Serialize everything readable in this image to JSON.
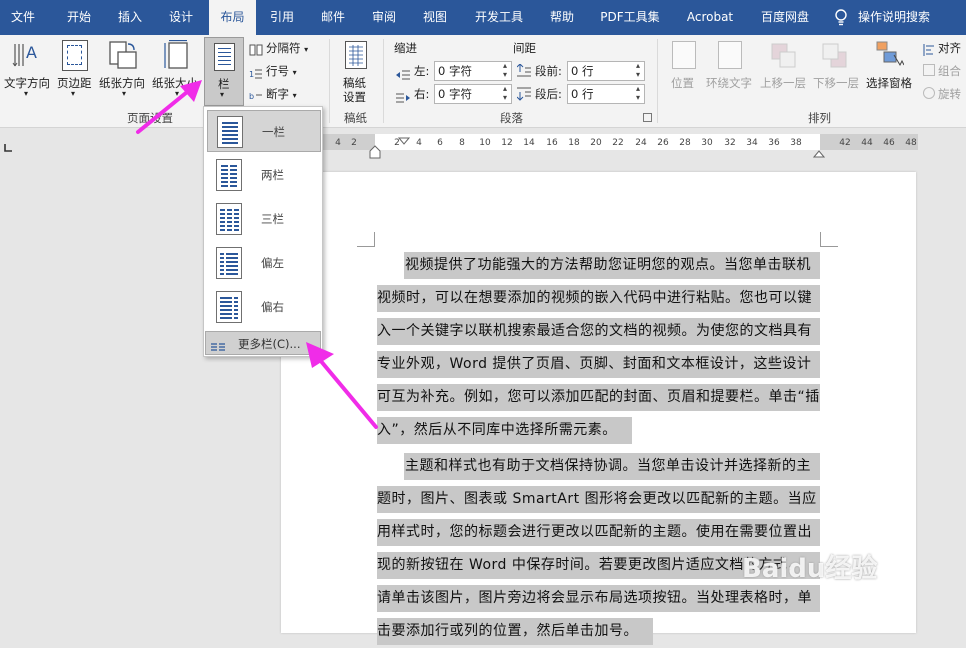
{
  "tabs": [
    {
      "label": "文件"
    },
    {
      "label": "开始"
    },
    {
      "label": "插入"
    },
    {
      "label": "设计"
    },
    {
      "label": "布局"
    },
    {
      "label": "引用"
    },
    {
      "label": "邮件"
    },
    {
      "label": "审阅"
    },
    {
      "label": "视图"
    },
    {
      "label": "开发工具"
    },
    {
      "label": "帮助"
    },
    {
      "label": "PDF工具集"
    },
    {
      "label": "Acrobat"
    },
    {
      "label": "百度网盘"
    }
  ],
  "search": {
    "label": "操作说明搜索"
  },
  "ribbon": {
    "page_setup": {
      "text_dir": "文字方向",
      "margins": "页边距",
      "orientation": "纸张方向",
      "size": "纸张大小",
      "columns": "栏",
      "breaks": "分隔符",
      "line_numbers": "行号",
      "hyphenation": "断字",
      "group": "页面设置"
    },
    "draft": {
      "label": "稿纸",
      "label2": "设置",
      "group": "稿纸"
    },
    "paragraph": {
      "indent": "缩进",
      "spacing": "间距",
      "left": "左:",
      "right": "右:",
      "before": "段前:",
      "after": "段后:",
      "left_val": "0 字符",
      "right_val": "0 字符",
      "before_val": "0 行",
      "after_val": "0 行",
      "group": "段落"
    },
    "arrange": {
      "position": "位置",
      "wrap": "环绕文字",
      "forward": "上移一层",
      "backward": "下移一层",
      "pane": "选择窗格",
      "align": "对齐",
      "group_btn": "组合",
      "rotate": "旋转",
      "group": "排列"
    }
  },
  "ruler_ticks": [
    "4",
    "2",
    "2",
    "4",
    "6",
    "8",
    "10",
    "12",
    "14",
    "16",
    "18",
    "20",
    "22",
    "24",
    "26",
    "28",
    "30",
    "32",
    "34",
    "36",
    "38",
    "42",
    "44",
    "46",
    "48"
  ],
  "columns_menu": {
    "items": [
      {
        "label": "一栏"
      },
      {
        "label": "两栏"
      },
      {
        "label": "三栏"
      },
      {
        "label": "偏左"
      },
      {
        "label": "偏右"
      }
    ],
    "more": "更多栏(C)..."
  },
  "document": {
    "lines": [
      "视频提供了功能强大的方法帮助您证明您的观点。当您单击联机",
      "视频时，可以在想要添加的视频的嵌入代码中进行粘贴。您也可以键",
      "入一个关键字以联机搜索最适合您的文档的视频。为使您的文档具有",
      "专业外观，Word 提供了页眉、页脚、封面和文本框设计，这些设计",
      "可互为补充。例如，您可以添加匹配的封面、页眉和提要栏。单击“插",
      "入”，然后从不同库中选择所需元素。",
      "主题和样式也有助于文档保持协调。当您单击设计并选择新的主",
      "题时，图片、图表或 SmartArt 图形将会更改以匹配新的主题。当应",
      "用样式时，您的标题会进行更改以匹配新的主题。使用在需要位置出",
      "现的新按钮在 Word 中保存时间。若要更改图片适应文档的方式，",
      "请单击该图片，图片旁边将会显示布局选项按钮。当处理表格时，单",
      "击要添加行或列的位置，然后单击加号。"
    ]
  },
  "watermark": "Baidu经验"
}
